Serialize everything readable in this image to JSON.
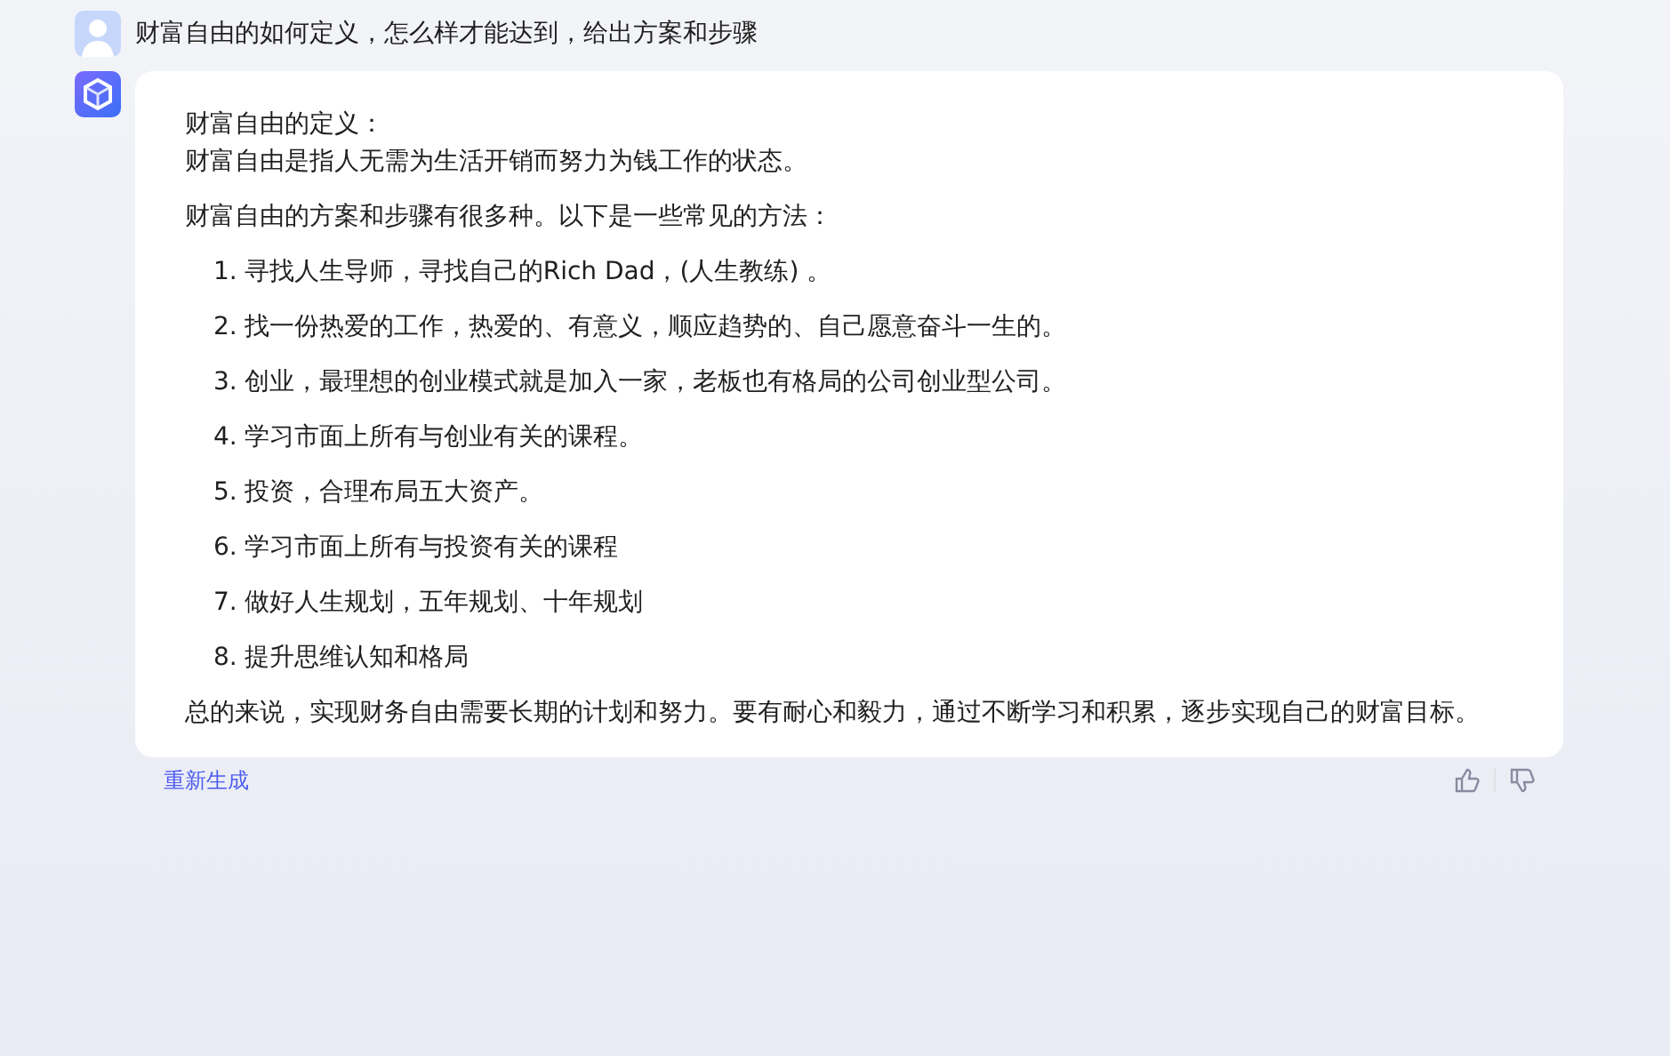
{
  "question": {
    "text": "财富自由的如何定义，怎么样才能达到，给出方案和步骤"
  },
  "answer": {
    "heading": "财富自由的定义：",
    "definition": "财富自由是指人无需为生活开销而努力为钱工作的状态。",
    "intro": "财富自由的方案和步骤有很多种。以下是一些常见的方法：",
    "steps": [
      {
        "number": "1.",
        "text": "寻找人生导师，寻找自己的Rich Dad，(人生教练) 。"
      },
      {
        "number": "2.",
        "text": "找一份热爱的工作，热爱的、有意义，顺应趋势的、自己愿意奋斗一生的。"
      },
      {
        "number": "3.",
        "text": "创业，最理想的创业模式就是加入一家，老板也有格局的公司创业型公司。"
      },
      {
        "number": "4.",
        "text": "学习市面上所有与创业有关的课程。"
      },
      {
        "number": "5.",
        "text": "投资，合理布局五大资产。"
      },
      {
        "number": "6.",
        "text": "学习市面上所有与投资有关的课程"
      },
      {
        "number": "7.",
        "text": "做好人生规划，五年规划、十年规划"
      },
      {
        "number": "8.",
        "text": "提升思维认知和格局"
      }
    ],
    "conclusion": "总的来说，实现财务自由需要长期的计划和努力。要有耐心和毅力，通过不断学习和积累，逐步实现自己的财富目标。"
  },
  "actions": {
    "regenerate": "重新生成"
  }
}
